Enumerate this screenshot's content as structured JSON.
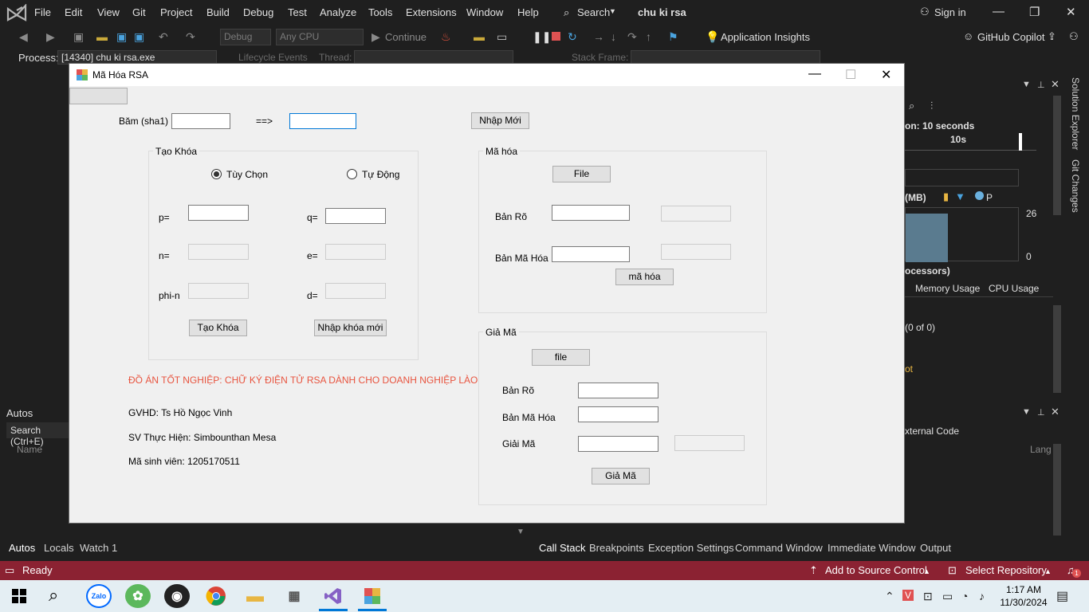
{
  "vs": {
    "menu": [
      "File",
      "Edit",
      "View",
      "Git",
      "Project",
      "Build",
      "Debug",
      "Test",
      "Analyze",
      "Tools",
      "Extensions",
      "Window",
      "Help"
    ],
    "search_label": "Search",
    "solution_title": "chu ki rsa",
    "sign_in": "Sign in",
    "toolbar": {
      "config": "Debug",
      "platform": "Any CPU",
      "continue": "Continue",
      "app_insights": "Application Insights",
      "copilot": "GitHub Copilot"
    },
    "process_bar": {
      "process_label": "Process:",
      "process_value": "[14340] chu ki rsa.exe",
      "lifecycle": "Lifecycle Events",
      "thread": "Thread:",
      "stack_frame": "Stack Frame:"
    },
    "diag": {
      "session": "on: 10 seconds",
      "tick": "10s",
      "mem_label": "(MB)",
      "legend_p": "P",
      "val_top": "26",
      "val_bottom": "0",
      "processors": "ocessors)",
      "tab_memory": "Memory Usage",
      "tab_cpu": "CPU Usage",
      "events_count": "(0 of 0)",
      "event_item": "ot"
    },
    "side_tabs": [
      "Solution Explorer",
      "Git Changes"
    ],
    "callstack": {
      "external": "xternal Code",
      "lang": "Lang"
    },
    "autos": {
      "title": "Autos",
      "search": "Search (Ctrl+E)",
      "name_col": "Name"
    },
    "bottom_left_tabs": [
      "Autos",
      "Locals",
      "Watch 1"
    ],
    "bottom_right_tabs": [
      "Call Stack",
      "Breakpoints",
      "Exception Settings",
      "Command Window",
      "Immediate Window",
      "Output"
    ],
    "status": {
      "ready": "Ready",
      "add_source": "Add to Source Control",
      "select_repo": "Select Repository",
      "notif_count": "1"
    }
  },
  "taskbar": {
    "zalo": "Zalo",
    "time": "1:17 AM",
    "date": "11/30/2024"
  },
  "dialog": {
    "title": "Mã Hóa RSA",
    "hash_label": "Băm (sha1)",
    "arrow": "==>",
    "hash_input": "",
    "hash_output": "",
    "new_input_button": "Nhập Mới",
    "keygen": {
      "title": "Tạo Khóa",
      "radio_custom": "Tùy Chọn",
      "radio_auto": "Tự Động",
      "selected": "custom",
      "p_label": "p=",
      "q_label": "q=",
      "n_label": "n=",
      "e_label": "e=",
      "phi_label": "phi-n",
      "d_label": "d=",
      "create_button": "Tạo Khóa",
      "new_key_button": "Nhập khóa mới"
    },
    "encrypt": {
      "title": "Mã hóa",
      "file_button": "File",
      "plain_label": "Bản Rõ",
      "cipher_label": "Bản Mã Hóa",
      "encrypt_button": "mã hóa"
    },
    "decrypt": {
      "title": "Giả Mã",
      "file_button": "file",
      "plain_label": "Bản Rõ",
      "cipher_label": "Bản Mã Hóa",
      "decrypt_label": "Giải Mã",
      "decrypt_button": "Giả Mã"
    },
    "project_title": "ĐỒ ÁN TỐT NGHIỆP: CHỮ KÝ ĐIỆN TỬ RSA DÀNH CHO DOANH NGHIỆP LÀO",
    "advisor": "GVHD: Ts Hồ Ngọc Vinh",
    "student": "SV Thực Hiện: Simbounthan Mesa",
    "student_id": "Mã sinh viên: 1205170511"
  }
}
